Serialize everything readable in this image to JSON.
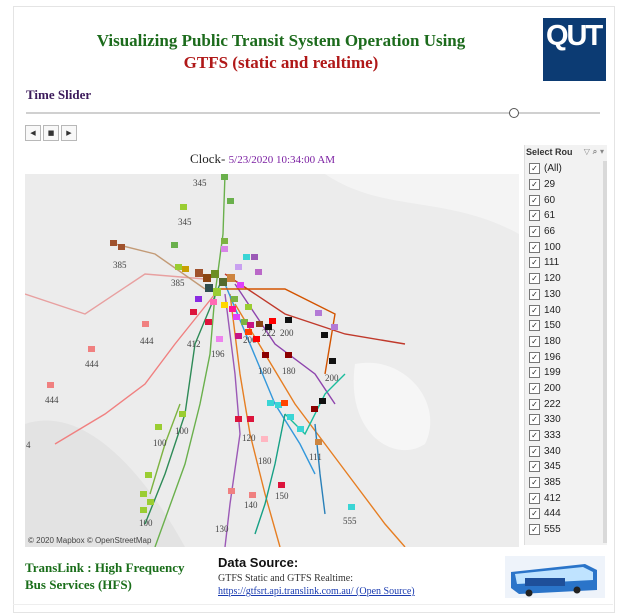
{
  "title": {
    "line1": "Visualizing Public Transit System Operation Using",
    "line2": "GTFS (static and realtime)"
  },
  "logo": "QUT",
  "slider": {
    "label": "Time Slider",
    "position": 0.85
  },
  "player": {
    "prev": "◀",
    "stop": "■",
    "next": "▶"
  },
  "clock": {
    "label": "Clock-",
    "value": "5/23/2020 10:34:00 AM"
  },
  "map": {
    "attribution": "© 2020 Mapbox © OpenStreetMap",
    "route_labels": [
      "345",
      "345",
      "385",
      "385",
      "444",
      "444",
      "444",
      "412",
      "196",
      "200",
      "222",
      "200",
      "180",
      "180",
      "200",
      "100",
      "100",
      "100",
      "120",
      "180",
      "140",
      "150",
      "130",
      "111",
      "555",
      "4"
    ]
  },
  "filter": {
    "header": "Select Rou",
    "icons": "▽ ⌕ ▾",
    "items": [
      "(All)",
      "29",
      "60",
      "61",
      "66",
      "100",
      "111",
      "120",
      "130",
      "140",
      "150",
      "180",
      "196",
      "199",
      "200",
      "222",
      "330",
      "333",
      "340",
      "345",
      "385",
      "412",
      "444",
      "555"
    ]
  },
  "footer": {
    "translink_line1": "TransLink : High Frequency",
    "translink_line2": "Bus Services (HFS)",
    "datasource_title": "Data Source:",
    "datasource_text": "GTFS Static and GTFS Realtime:",
    "datasource_link": "https://gtfsrt.api.translink.com.au/ (Open Source)"
  }
}
